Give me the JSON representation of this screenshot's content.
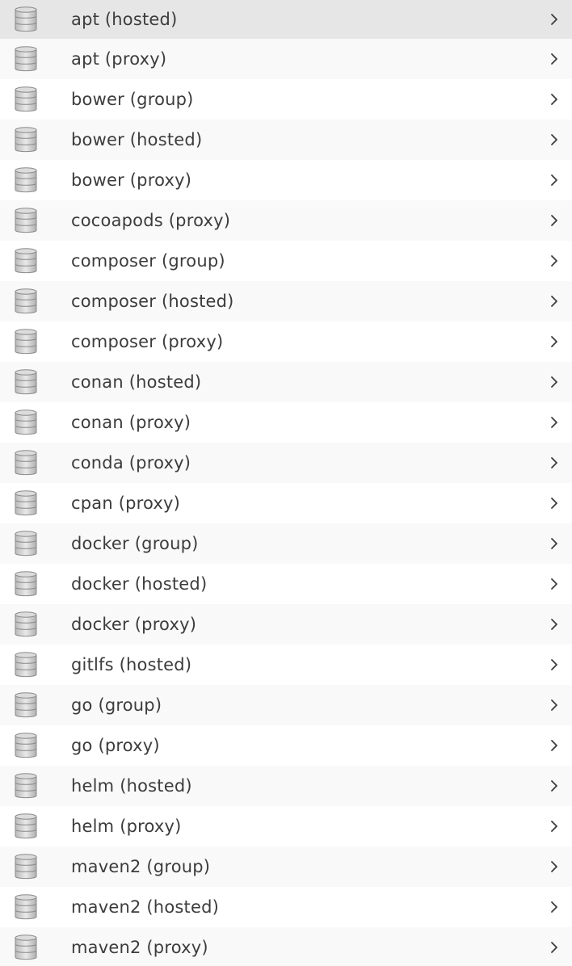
{
  "repositories": [
    {
      "label": "apt (hosted)",
      "selected": true
    },
    {
      "label": "apt (proxy)"
    },
    {
      "label": "bower (group)"
    },
    {
      "label": "bower (hosted)"
    },
    {
      "label": "bower (proxy)"
    },
    {
      "label": "cocoapods (proxy)"
    },
    {
      "label": "composer (group)"
    },
    {
      "label": "composer (hosted)"
    },
    {
      "label": "composer (proxy)"
    },
    {
      "label": "conan (hosted)"
    },
    {
      "label": "conan (proxy)"
    },
    {
      "label": "conda (proxy)"
    },
    {
      "label": "cpan (proxy)"
    },
    {
      "label": "docker (group)"
    },
    {
      "label": "docker (hosted)"
    },
    {
      "label": "docker (proxy)"
    },
    {
      "label": "gitlfs (hosted)"
    },
    {
      "label": "go (group)"
    },
    {
      "label": "go (proxy)"
    },
    {
      "label": "helm (hosted)"
    },
    {
      "label": "helm (proxy)"
    },
    {
      "label": "maven2 (group)"
    },
    {
      "label": "maven2 (hosted)"
    },
    {
      "label": "maven2 (proxy)"
    }
  ],
  "icons": {
    "row_icon": "database-icon",
    "row_action": "chevron-right-icon"
  },
  "colors": {
    "selected_row": "#e6e6e6",
    "stripe_row": "#f9f9f9",
    "text": "#3c3c3c"
  }
}
